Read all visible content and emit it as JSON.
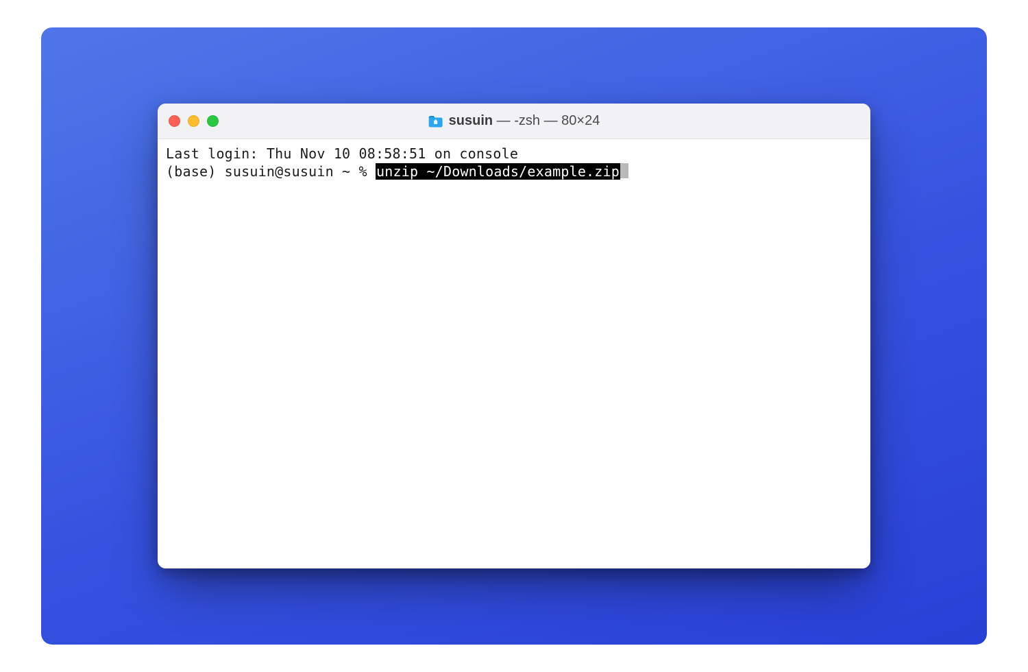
{
  "window": {
    "traffic": {
      "close_color": "#fe5f57",
      "minimize_color": "#febc2e",
      "zoom_color": "#28c840"
    },
    "title": {
      "icon": "folder-icon",
      "name": "susuin",
      "separator1": " — ",
      "shell": "-zsh",
      "separator2": " — ",
      "dimensions": "80×24"
    }
  },
  "terminal": {
    "line1": "Last login: Thu Nov 10 08:58:51 on console",
    "line2_prompt": "(base) susuin@susuin ~ % ",
    "line2_command": "unzip ~/Downloads/example.zip"
  }
}
